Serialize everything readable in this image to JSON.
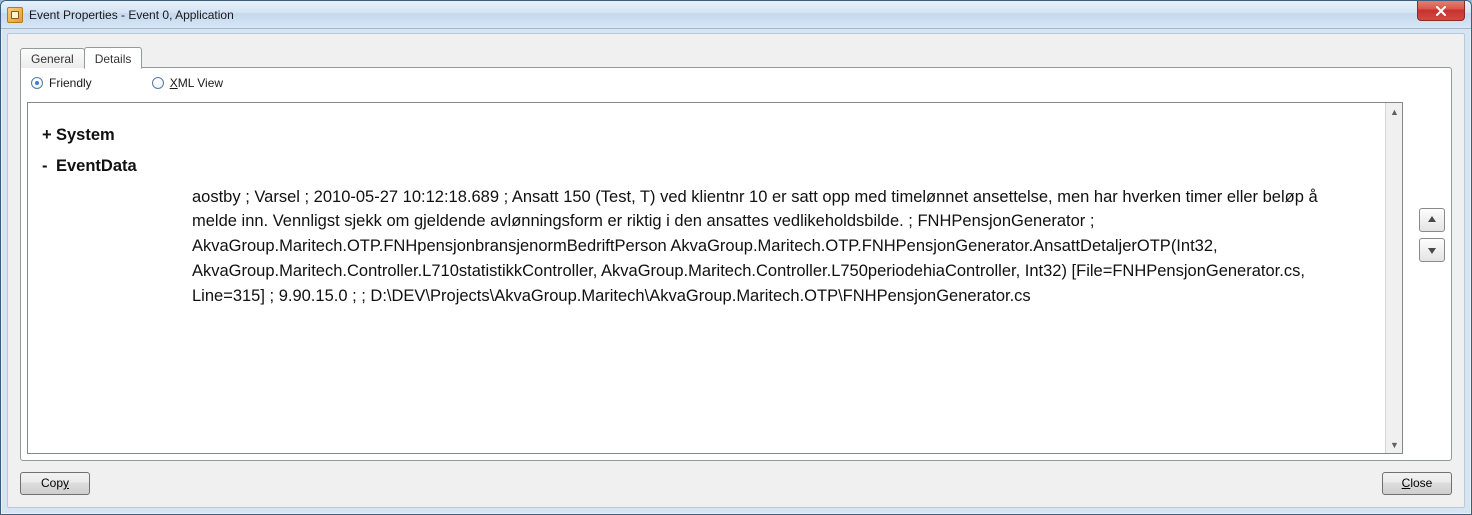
{
  "window": {
    "title": "Event Properties - Event 0, Application"
  },
  "tabs": {
    "general": "General",
    "details": "Details",
    "active": "details"
  },
  "view": {
    "friendly_label": "Friendly",
    "xml_label_prefix": "X",
    "xml_label_rest": "ML View",
    "selected": "friendly"
  },
  "tree": {
    "system_label": "System",
    "eventdata_label": "EventData",
    "eventdata_body": "aostby ; Varsel ; 2010-05-27 10:12:18.689 ; Ansatt 150 (Test, T) ved klientnr 10 er satt opp med timelønnet ansettelse, men har hverken timer eller beløp å melde inn. Vennligst sjekk om gjeldende avlønningsform er riktig i den ansattes vedlikeholdsbilde. ; FNHPensjonGenerator ; AkvaGroup.Maritech.OTP.FNHpensjonbransjenormBedriftPerson AkvaGroup.Maritech.OTP.FNHPensjonGenerator.AnsattDetaljerOTP(Int32, AkvaGroup.Maritech.Controller.L710statistikkController, AkvaGroup.Maritech.Controller.L750periodehiaController, Int32) [File=FNHPensjonGenerator.cs, Line=315] ; 9.90.15.0 ; ; D:\\DEV\\Projects\\AkvaGroup.Maritech\\AkvaGroup.Maritech.OTP\\FNHPensjonGenerator.cs"
  },
  "buttons": {
    "copy_prefix": "Cop",
    "copy_ul": "y",
    "close_ul": "C",
    "close_rest": "lose"
  }
}
